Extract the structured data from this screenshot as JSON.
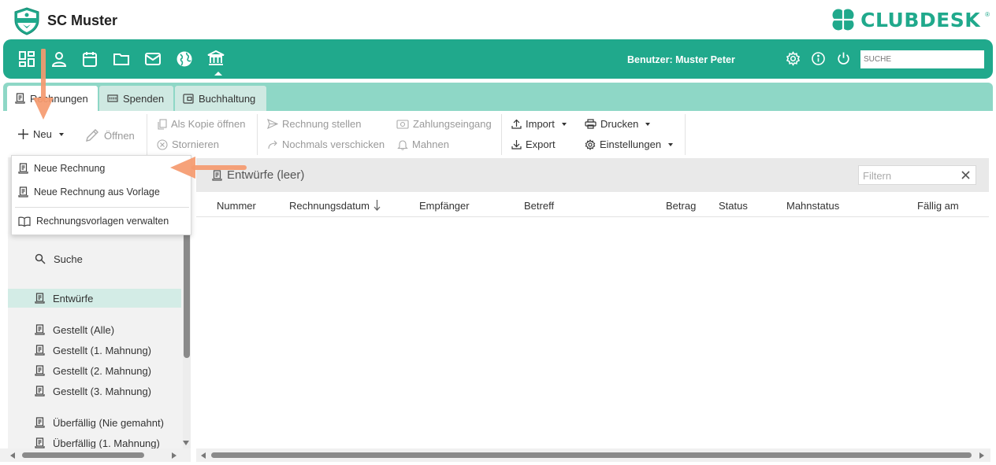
{
  "header": {
    "badge_text": "SC MUSTER",
    "club_name": "SC Muster",
    "brand_name": "CLUBDESK",
    "brand_reg": "®"
  },
  "navbar": {
    "icons": [
      "dashboard-icon",
      "person-icon",
      "calendar-icon",
      "folder-icon",
      "mail-icon",
      "globe-icon",
      "bank-icon"
    ],
    "active_icon": "bank-icon",
    "user_label": "Benutzer: Muster Peter",
    "search_placeholder": "SUCHE"
  },
  "tabs": [
    {
      "label": "Rechnungen",
      "icon": "invoice-icon",
      "active": true
    },
    {
      "label": "Spenden",
      "icon": "donation-icon",
      "active": false
    },
    {
      "label": "Buchhaltung",
      "icon": "wallet-icon",
      "active": false
    }
  ],
  "toolbar": {
    "new_label": "Neu",
    "open_label": "Öffnen",
    "copy_open_label": "Als Kopie öffnen",
    "cancel_label": "Stornieren",
    "issue_invoice_label": "Rechnung stellen",
    "resend_label": "Nochmals verschicken",
    "payment_label": "Zahlungseingang",
    "remind_label": "Mahnen",
    "import_label": "Import",
    "export_label": "Export",
    "print_label": "Drucken",
    "settings_label": "Einstellungen"
  },
  "dropdown": {
    "items": [
      "Neue Rechnung",
      "Neue Rechnung aus Vorlage",
      "Rechnungsvorlagen verwalten"
    ]
  },
  "sidebar": {
    "search_label": "Suche",
    "items": [
      {
        "label": "Entwürfe",
        "active": true
      },
      {
        "label": "Gestellt (Alle)",
        "active": false
      },
      {
        "label": "Gestellt (1. Mahnung)",
        "active": false
      },
      {
        "label": "Gestellt (2. Mahnung)",
        "active": false
      },
      {
        "label": "Gestellt (3. Mahnung)",
        "active": false
      },
      {
        "label": "Überfällig (Nie gemahnt)",
        "active": false
      },
      {
        "label": "Überfällig (1. Mahnung)",
        "active": false
      }
    ]
  },
  "content": {
    "title": "Entwürfe (leer)",
    "filter_placeholder": "Filtern",
    "columns": [
      "Nummer",
      "Rechnungsdatum",
      "Empfänger",
      "Betreff",
      "Betrag",
      "Status",
      "Mahnstatus",
      "Fällig am"
    ],
    "sorted_column": "Rechnungsdatum",
    "sort_direction": "descending",
    "rows": []
  },
  "colors": {
    "brand": "#20a98c",
    "tab_band": "#8ed7c6",
    "annotation_arrow": "#f59a6f",
    "active_sidebar": "#d3ece6"
  }
}
